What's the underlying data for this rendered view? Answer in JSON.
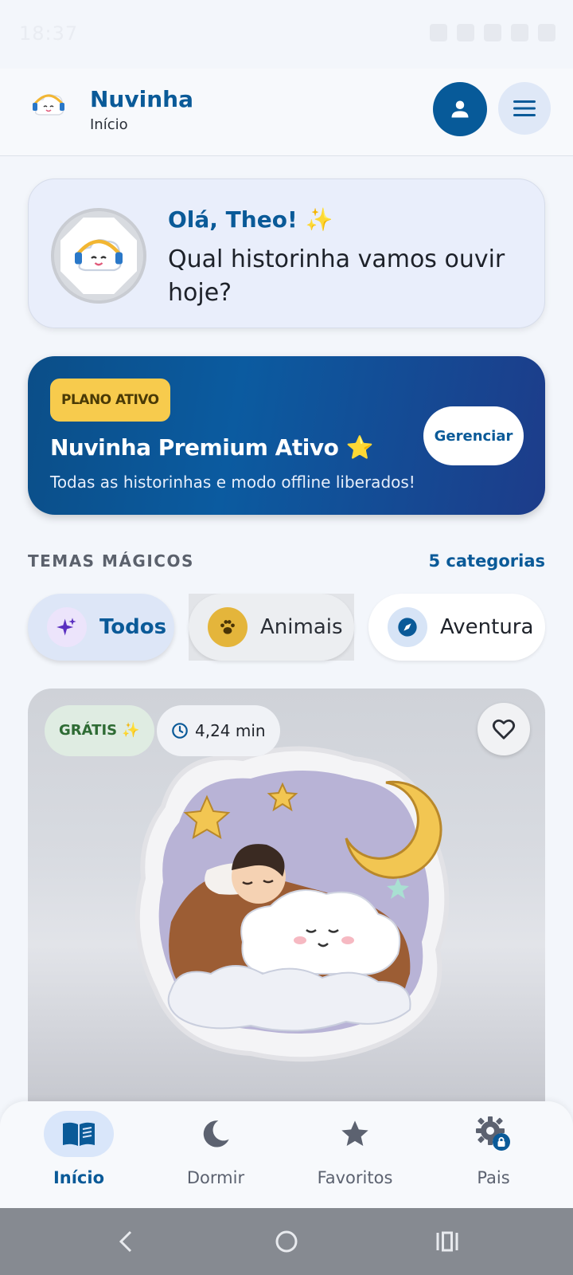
{
  "status_bar": {
    "time": "18:37"
  },
  "header": {
    "app_name": "Nuvinha",
    "subtitle": "Início"
  },
  "greeting": {
    "hello": "Olá, Theo! ✨",
    "question": "Qual historinha vamos ouvir hoje?"
  },
  "premium": {
    "badge": "PLANO ATIVO",
    "title": "Nuvinha Premium Ativo ⭐",
    "subtitle": "Todas as historinhas e modo offline liberados!",
    "manage_label": "Gerenciar"
  },
  "themes": {
    "title": "TEMAS MÁGICOS",
    "count": "5 categorias",
    "chips": [
      {
        "label": "Todos",
        "icon": "sparkles-icon",
        "selected": true
      },
      {
        "label": "Animais",
        "icon": "paw-icon",
        "selected": false
      },
      {
        "label": "Aventura",
        "icon": "compass-icon",
        "selected": false
      }
    ]
  },
  "story": {
    "badge": "GRÁTIS ✨",
    "duration": "4,24 min",
    "favorite": false
  },
  "bottom_nav": [
    {
      "label": "Início",
      "icon": "book-icon",
      "active": true
    },
    {
      "label": "Dormir",
      "icon": "moon-icon",
      "active": false
    },
    {
      "label": "Favoritos",
      "icon": "star-icon",
      "active": false
    },
    {
      "label": "Pais",
      "icon": "gear-lock-icon",
      "active": false
    }
  ],
  "colors": {
    "primary": "#0a5a98",
    "accent": "#f7cb4d",
    "background": "#f3f6fb"
  }
}
